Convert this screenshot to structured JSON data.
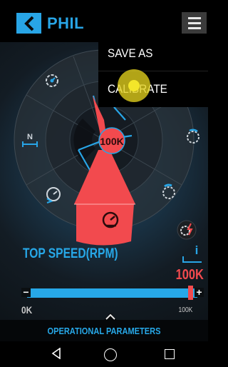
{
  "header": {
    "title": "PHIL",
    "back_icon": "chevron-left-icon",
    "menu_icon": "hamburger-menu-icon"
  },
  "menu": {
    "items": [
      {
        "label": "SAVE AS"
      },
      {
        "label": "CALIBRATE"
      }
    ]
  },
  "dial": {
    "center_value": "100K",
    "icons": [
      "speed-clock-icon",
      "compass-north-icon",
      "gauge-reverse-icon",
      "speedometer-icon",
      "rotate-gear-icon",
      "settings-icon",
      "acceleration-gear-icon",
      "gear-bolt-icon"
    ]
  },
  "parameter": {
    "label": "TOP SPEED(RPM)",
    "value": "100K",
    "min_label": "0K",
    "max_label": "100K",
    "level": 0.97
  },
  "bottom_panel": {
    "label": "OPERATIONAL PARAMETERS"
  },
  "colors": {
    "accent": "#28a5e6",
    "highlight": "#f24a4e",
    "touch": "#f3e62a"
  }
}
